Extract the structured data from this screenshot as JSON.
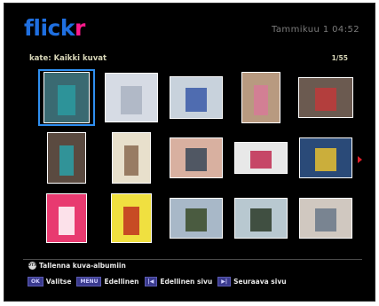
{
  "header": {
    "logo_part1": "flick",
    "logo_part2": "r",
    "clock": "Tammikuu 1 04:52",
    "breadcrumb": "kate: Kaikki kuvat",
    "counter": "1/55"
  },
  "photos": [
    {
      "name": "photo-woman-teal-top",
      "bg": "#3a6a72",
      "fig": "#2c9aa0"
    },
    {
      "name": "photo-screenshot-list",
      "bg": "#d6dbe4",
      "fig": "#aab3c2"
    },
    {
      "name": "photo-screenshot-window",
      "bg": "#c8d2dc",
      "fig": "#3a5aa8"
    },
    {
      "name": "photo-person-pink-shirt",
      "bg": "#b89a80",
      "fig": "#d67a98"
    },
    {
      "name": "photo-man-with-art",
      "bg": "#6b5a50",
      "fig": "#c03a3a"
    },
    {
      "name": "photo-woman-teal-standing",
      "bg": "#5a4a40",
      "fig": "#2aa0a8"
    },
    {
      "name": "photo-woman-doorway",
      "bg": "#e8e0cc",
      "fig": "#8a6a50"
    },
    {
      "name": "photo-sunset-lake",
      "bg": "#d8b0a0",
      "fig": "#384858"
    },
    {
      "name": "photo-three-paintings",
      "bg": "#e8e8e8",
      "fig": "#c02a50"
    },
    {
      "name": "photo-blue-painting",
      "bg": "#2a4a78",
      "fig": "#e8c030"
    },
    {
      "name": "photo-pink-painting",
      "bg": "#e83a70",
      "fig": "#ffffff"
    },
    {
      "name": "photo-yellow-painting",
      "bg": "#f0e040",
      "fig": "#c03020"
    },
    {
      "name": "photo-palm-lake",
      "bg": "#a8b8c8",
      "fig": "#3a4a28"
    },
    {
      "name": "photo-palm-shore",
      "bg": "#b8c8d0",
      "fig": "#2a3a28"
    },
    {
      "name": "photo-calm-lake",
      "bg": "#d0c8c0",
      "fig": "#6a7888"
    }
  ],
  "footer": {
    "save_icon_label": "DTX",
    "save_label": "Tallenna kuva-albumiin",
    "ok_key": "OK",
    "ok_label": "Valitse",
    "menu_key": "MENU",
    "menu_label": "Edellinen",
    "prev_key": "|◀",
    "prev_label": "Edellinen sivu",
    "next_key": "▶|",
    "next_label": "Seuraava sivu"
  }
}
